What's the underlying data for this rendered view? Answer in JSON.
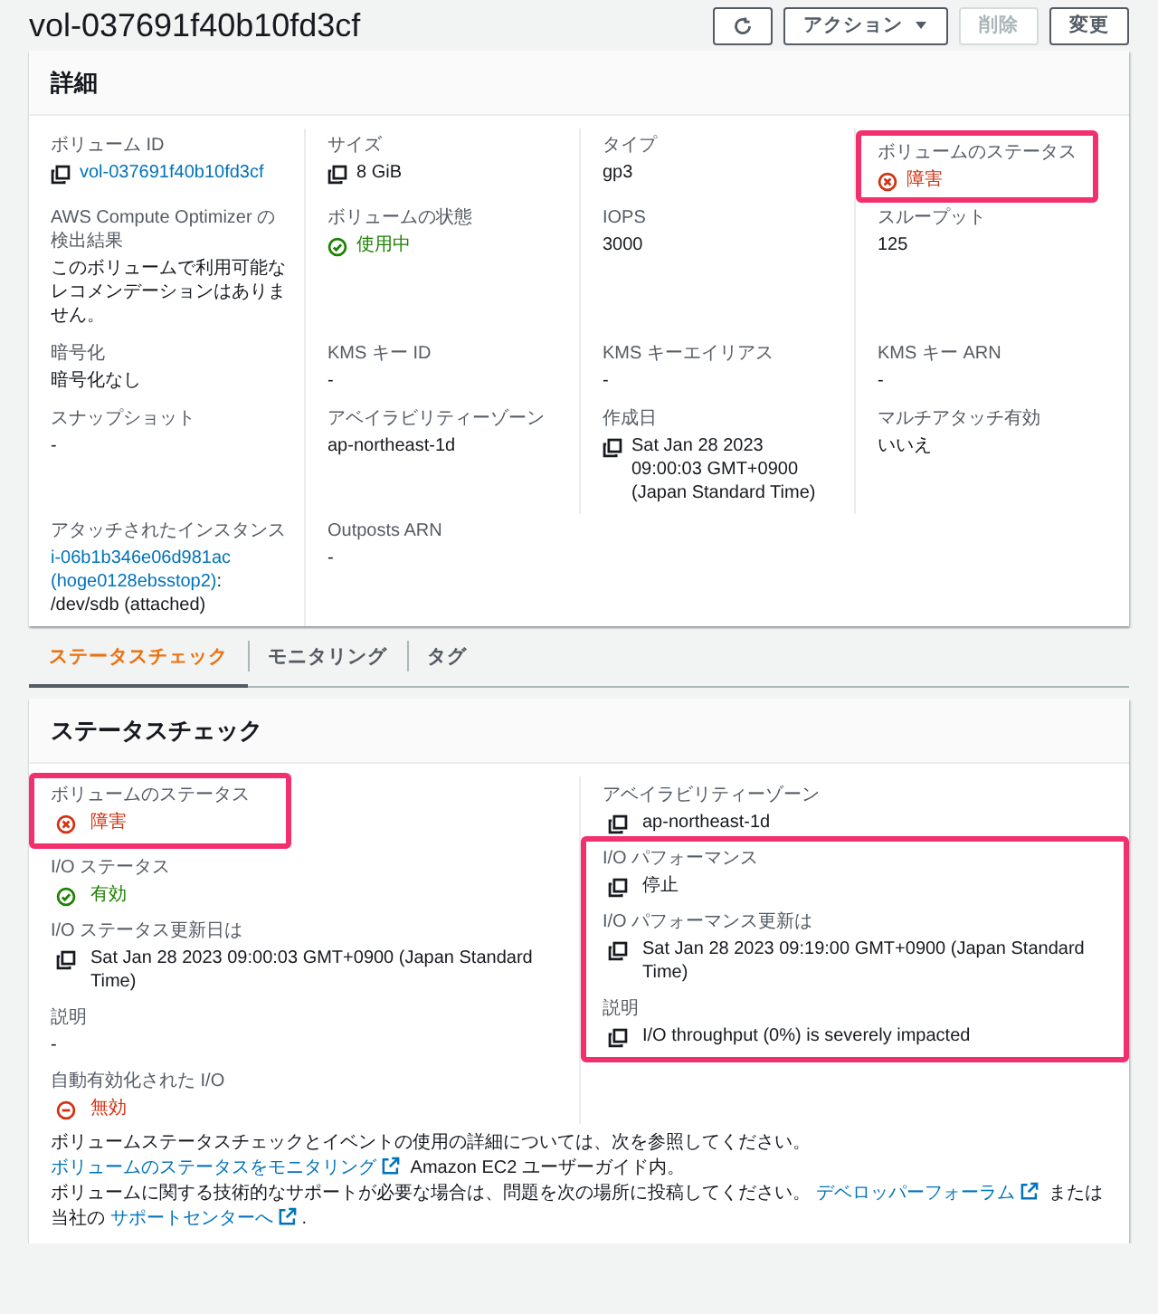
{
  "header": {
    "title": "vol-037691f40b10fd3cf",
    "buttons": [
      {
        "kind": "refresh",
        "disabled": false
      },
      {
        "kind": "dropdown",
        "label": "アクション",
        "disabled": false
      },
      {
        "kind": "plain",
        "label": "削除",
        "disabled": true
      },
      {
        "kind": "plain",
        "label": "変更",
        "disabled": false
      }
    ]
  },
  "details": {
    "title": "詳細",
    "fields": [
      {
        "label": "ボリューム ID",
        "kind": "copy_link",
        "value": "vol-037691f40b10fd3cf",
        "highlighted": false
      },
      {
        "label": "サイズ",
        "kind": "copy",
        "value": "8 GiB",
        "highlighted": false
      },
      {
        "label": "タイプ",
        "kind": "text",
        "value": "gp3",
        "highlighted": false
      },
      {
        "label": "ボリュームのステータス",
        "kind": "error",
        "value": "障害",
        "highlighted": true
      },
      {
        "label": "AWS Compute Optimizer の検出結果",
        "kind": "text",
        "value": "このボリュームで利用可能なレコメンデーションはありません。",
        "highlighted": false
      },
      {
        "label": "ボリュームの状態",
        "kind": "success",
        "value": "使用中",
        "highlighted": false
      },
      {
        "label": "IOPS",
        "kind": "text",
        "value": "3000",
        "highlighted": false
      },
      {
        "label": "スループット",
        "kind": "text",
        "value": "125",
        "highlighted": false
      },
      {
        "label": "暗号化",
        "kind": "text",
        "value": "暗号化なし",
        "highlighted": false
      },
      {
        "label": "KMS キー ID",
        "kind": "text",
        "value": "-",
        "highlighted": false
      },
      {
        "label": "KMS キーエイリアス",
        "kind": "text",
        "value": "-",
        "highlighted": false
      },
      {
        "label": "KMS キー ARN",
        "kind": "text",
        "value": "-",
        "highlighted": false
      },
      {
        "label": "スナップショット",
        "kind": "text",
        "value": "-",
        "highlighted": false
      },
      {
        "label": "アベイラビリティーゾーン",
        "kind": "text",
        "value": "ap-northeast-1d",
        "highlighted": false
      },
      {
        "label": "作成日",
        "kind": "copy",
        "value": "Sat Jan 28 2023 09:00:03 GMT+0900 (Japan Standard Time)",
        "highlighted": false
      },
      {
        "label": "マルチアタッチ有効",
        "kind": "text",
        "value": "いいえ",
        "highlighted": false
      },
      {
        "label": "アタッチされたインスタンス",
        "kind": "instance",
        "links": [
          "i-06b1b346e06d981ac",
          "(hoge0128ebsstop2)"
        ],
        "value": ": /dev/sdb (attached)",
        "highlighted": false
      },
      {
        "label": "Outposts ARN",
        "kind": "text",
        "value": "-",
        "highlighted": false
      }
    ]
  },
  "tabs": [
    {
      "label": "ステータスチェック",
      "selected": true
    },
    {
      "label": "モニタリング",
      "selected": false
    },
    {
      "label": "タグ",
      "selected": false
    }
  ],
  "status_check": {
    "title": "ステータスチェック",
    "left_column": [
      {
        "label": "ボリュームのステータス",
        "kind": "error",
        "value": "障害",
        "highlighted": true
      },
      {
        "label": "I/O ステータス",
        "kind": "success",
        "value": "有効",
        "highlighted": false
      },
      {
        "label": "I/O ステータス更新日は",
        "kind": "copy",
        "value": "Sat Jan 28 2023 09:00:03 GMT+0900 (Japan Standard Time)",
        "highlighted": false
      },
      {
        "label": "説明",
        "kind": "text",
        "value": "-",
        "highlighted": false
      },
      {
        "label": "自動有効化された I/O",
        "kind": "disabled",
        "value": "無効",
        "highlighted": false
      }
    ],
    "right_column": [
      {
        "label": "アベイラビリティーゾーン",
        "kind": "copy",
        "value": "ap-northeast-1d",
        "highlighted": false
      },
      {
        "label": "I/O パフォーマンス",
        "kind": "copy",
        "value": "停止",
        "highlighted": true
      },
      {
        "label": "I/O パフォーマンス更新は",
        "kind": "copy",
        "value": "Sat Jan 28 2023 09:19:00 GMT+0900 (Japan Standard Time)",
        "highlighted": true
      },
      {
        "label": "説明",
        "kind": "copy",
        "value": "I/O throughput (0%) is severely impacted",
        "highlighted": true
      }
    ],
    "notes": [
      [
        {
          "kind": "text",
          "text": "ボリュームステータスチェックとイベントの使用の詳細については、次を参照してください。 "
        },
        {
          "kind": "link",
          "text": "ボリュームのステータスをモニタリング"
        },
        {
          "kind": "text",
          "text": " Amazon EC2 ユーザーガイド内。"
        }
      ],
      [
        {
          "kind": "text",
          "text": "ボリュームに関する技術的なサポートが必要な場合は、問題を次の場所に投稿してください。 "
        },
        {
          "kind": "link",
          "text": "デベロッパーフォーラム"
        },
        {
          "kind": "text",
          "text": " または当社の "
        },
        {
          "kind": "link",
          "text": "サポートセンターへ"
        },
        {
          "kind": "text",
          "text": "."
        }
      ]
    ]
  }
}
